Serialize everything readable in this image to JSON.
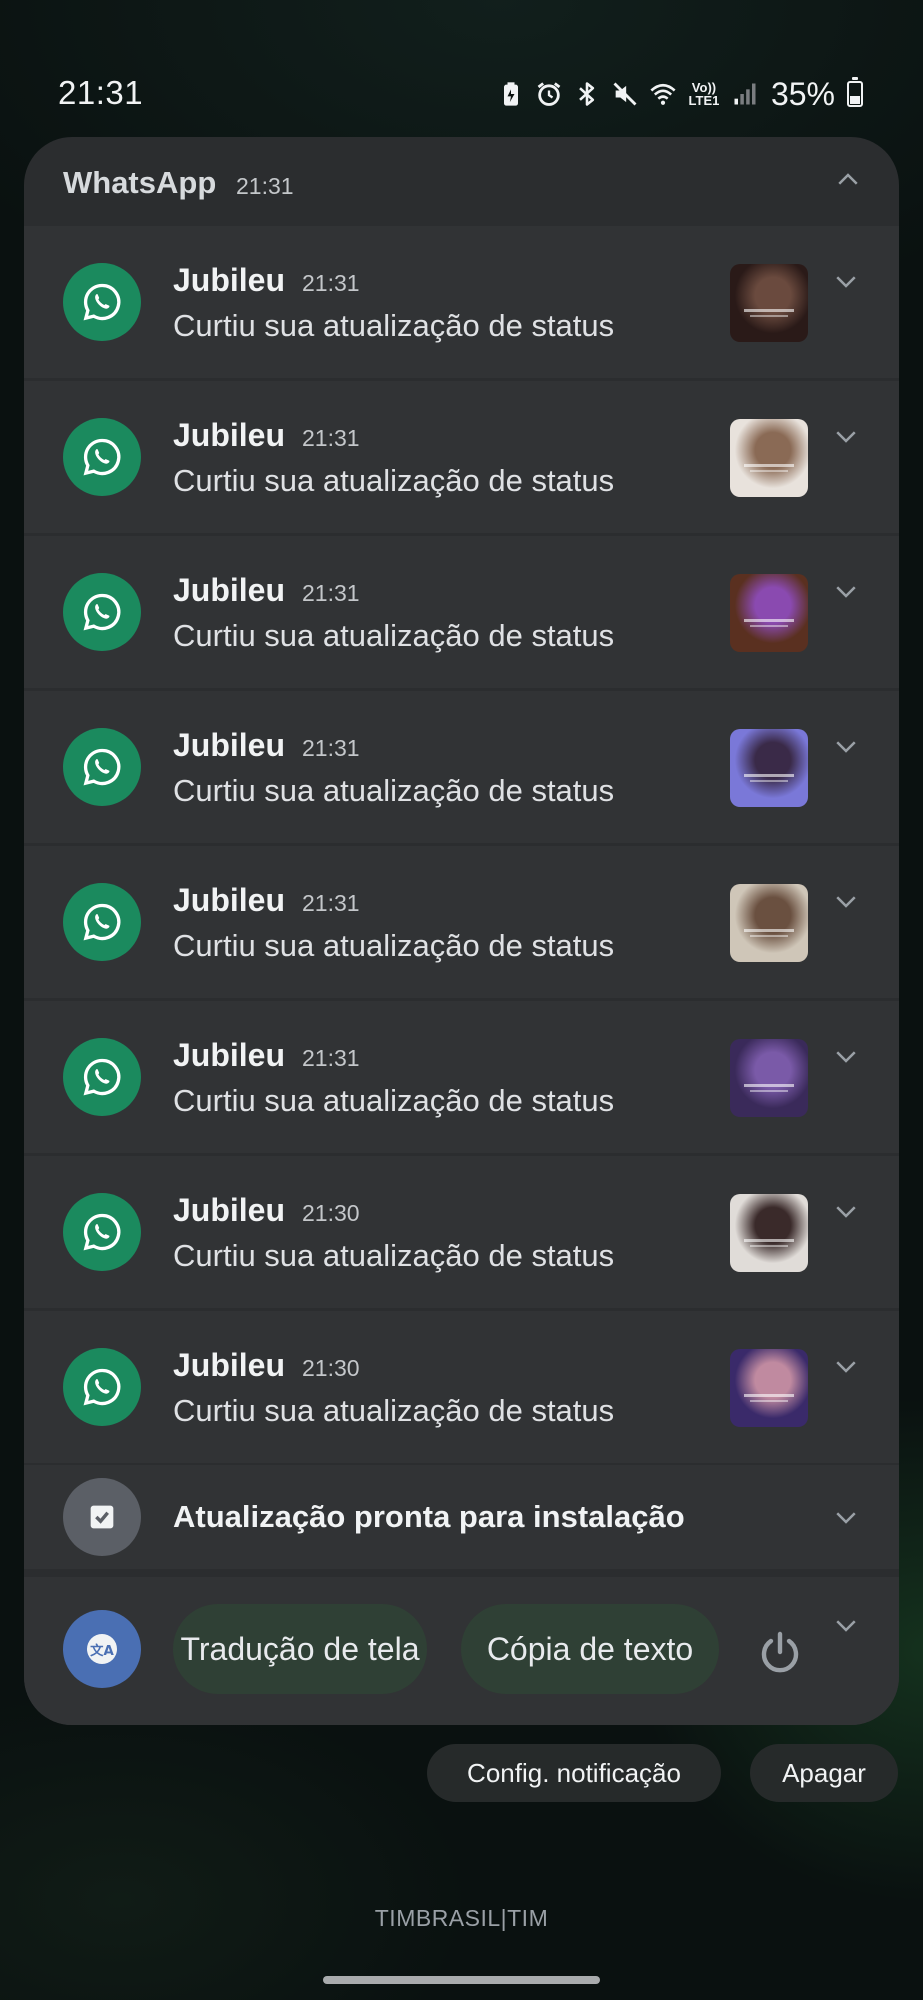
{
  "status_bar": {
    "time": "21:31",
    "network": [
      "Vo))",
      "LTE1"
    ],
    "battery_percent": "35%",
    "icons": [
      "battery-saver-icon",
      "alarm-icon",
      "bluetooth-icon",
      "mute-icon",
      "wifi-icon",
      "volte-icon",
      "signal-icon",
      "battery-icon"
    ]
  },
  "group": {
    "app_name": "WhatsApp",
    "time": "21:31",
    "accent_color": "#1b8a5e",
    "notifications": [
      {
        "title": "Jubileu",
        "time": "21:31",
        "body": "Curtiu sua atualização de status",
        "thumb_colors": [
          "#2a1a18",
          "#6a4a3e",
          "#101010"
        ]
      },
      {
        "title": "Jubileu",
        "time": "21:31",
        "body": "Curtiu sua atualização de status",
        "thumb_colors": [
          "#e8e2dc",
          "#8a6a55",
          "#4a3a30"
        ]
      },
      {
        "title": "Jubileu",
        "time": "21:31",
        "body": "Curtiu sua atualização de status",
        "thumb_colors": [
          "#5a3020",
          "#8a4ab0",
          "#c07048"
        ]
      },
      {
        "title": "Jubileu",
        "time": "21:31",
        "body": "Curtiu sua atualização de status",
        "thumb_colors": [
          "#7a78d8",
          "#3a2a48",
          "#b0a8f0"
        ]
      },
      {
        "title": "Jubileu",
        "time": "21:31",
        "body": "Curtiu sua atualização de status",
        "thumb_colors": [
          "#cfc6b8",
          "#6a5040",
          "#3a3a30"
        ]
      },
      {
        "title": "Jubileu",
        "time": "21:31",
        "body": "Curtiu sua atualização de status",
        "thumb_colors": [
          "#3a2a5a",
          "#7a5aa8",
          "#1a1230"
        ]
      },
      {
        "title": "Jubileu",
        "time": "21:30",
        "body": "Curtiu sua atualização de status",
        "thumb_colors": [
          "#e0dcd8",
          "#3a2a2a",
          "#1a1a1a"
        ]
      },
      {
        "title": "Jubileu",
        "time": "21:30",
        "body": "Curtiu sua atualização de status",
        "thumb_colors": [
          "#3a2a6a",
          "#c08aa0",
          "#6a4ab0"
        ]
      }
    ]
  },
  "system_update": {
    "title": "Atualização pronta para instalação"
  },
  "translate_tools": {
    "chips": [
      "Tradução de tela",
      "Cópia de texto"
    ]
  },
  "actions": {
    "settings_label": "Config. notificação",
    "clear_label": "Apagar"
  },
  "carrier": "TIMBRASIL|TIM"
}
